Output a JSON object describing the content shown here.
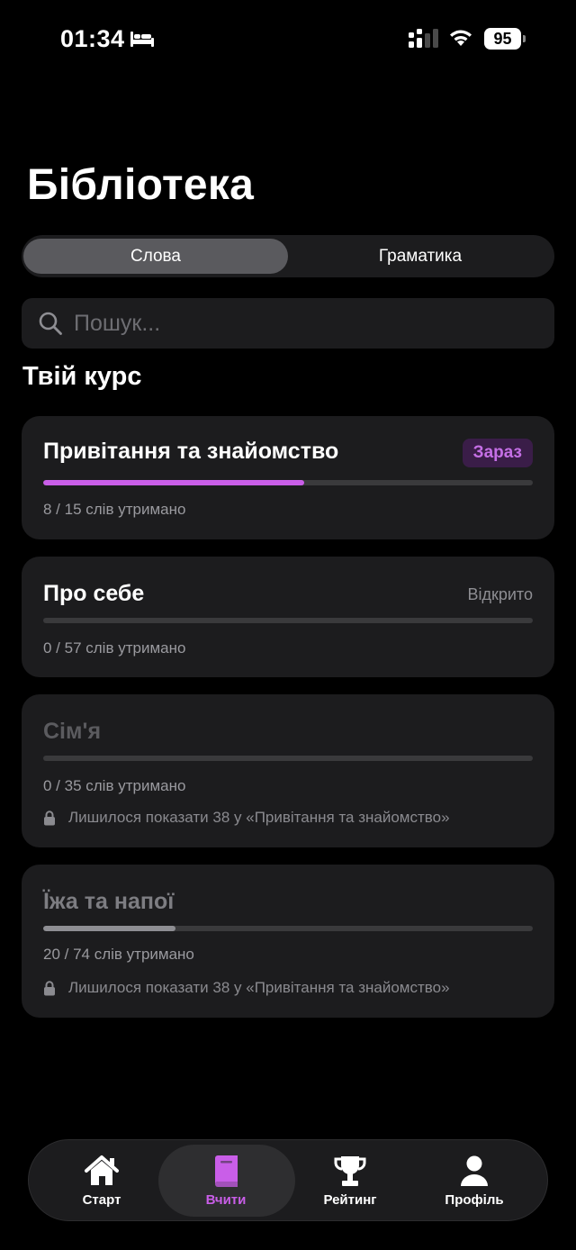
{
  "status_bar": {
    "time": "01:34",
    "battery": "95"
  },
  "page_title": "Бібліотека",
  "tabs": [
    {
      "label": "Слова",
      "active": true
    },
    {
      "label": "Граматика",
      "active": false
    }
  ],
  "search": {
    "placeholder": "Пошук..."
  },
  "section_title": "Твій курс",
  "courses": [
    {
      "title": "Привітання та знайомство",
      "status": "Зараз",
      "words": "8 / 15 слів утримано",
      "progress": 0.533
    },
    {
      "title": "Про себе",
      "status": "Відкрито",
      "words": "0 / 57 слів утримано",
      "progress": 0
    },
    {
      "title": "Сім'я",
      "words": "0 / 35 слів утримано",
      "progress": 0,
      "lock_note": "Лишилося показати 38 у «Привітання та знайомство»"
    },
    {
      "title": "Їжа та напої",
      "words": "20 / 74 слів утримано",
      "progress": 0.27,
      "lock_note": "Лишилося показати 38 у «Привітання та знайомство»"
    }
  ],
  "nav": [
    {
      "label": "Старт",
      "icon": "home-icon"
    },
    {
      "label": "Вчити",
      "icon": "book-icon",
      "active": true
    },
    {
      "label": "Рейтинг",
      "icon": "trophy-icon"
    },
    {
      "label": "Профіль",
      "icon": "person-icon"
    }
  ],
  "colors": {
    "accent": "#c95ee8",
    "accent_badge_bg": "#3a1d48",
    "card_bg": "#1c1c1e",
    "track": "#3a3a3c",
    "muted_fill": "#8e8e93"
  }
}
